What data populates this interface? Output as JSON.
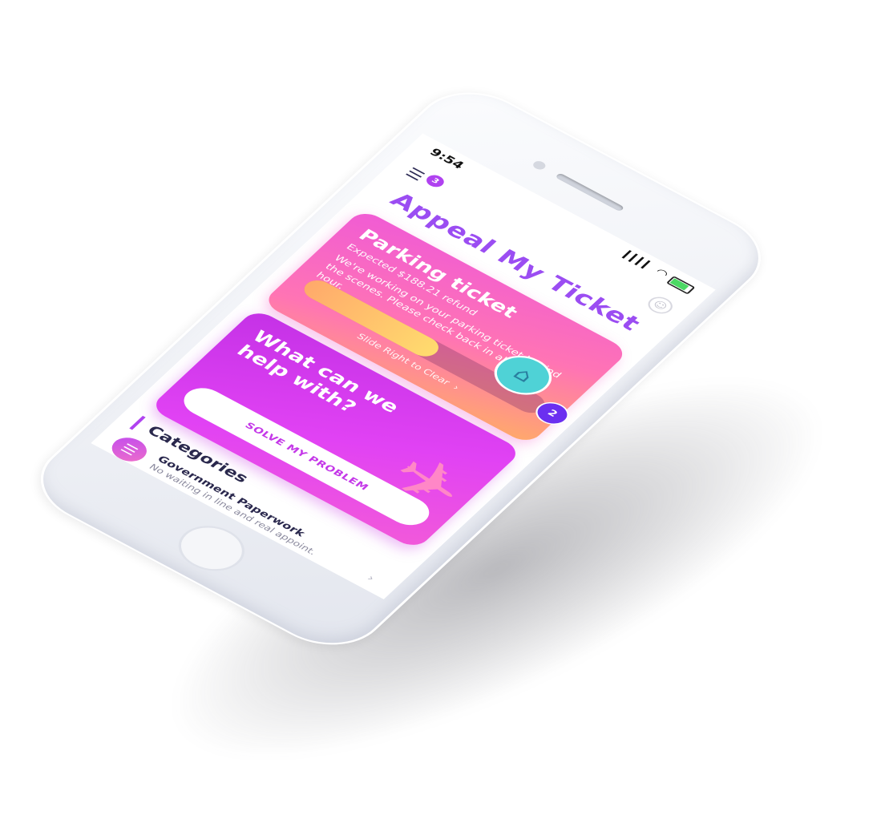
{
  "status_bar": {
    "time": "9:54",
    "location_glyph": "➤",
    "signal_glyph": "▎▎▎▎",
    "wifi_glyph": "◠"
  },
  "header": {
    "menu_glyph": "☰",
    "menu_badge": "3",
    "profile_glyph": "☺"
  },
  "app_title": "Appeal My Ticket",
  "ticket_card": {
    "title": "Parking ticket",
    "refund": "Expected $188.21 refund",
    "message": "We're working on your parking ticket behind the scenes. Please check back in about 1 hour.",
    "slider_hint": "Slide Right to Clear",
    "slider_chevron": "›",
    "progress": 0.55,
    "court_glyph": "⌂",
    "notification_count": "2"
  },
  "help_card": {
    "title": "What can we help with?",
    "button_label": "SOLVE MY PROBLEM",
    "plane_glyph": "✈"
  },
  "categories": {
    "heading": "Categories",
    "items": [
      {
        "name": "Government Paperwork",
        "description": "No waiting in line and real appoint.",
        "icon_glyph": "☰",
        "chevron": "›"
      }
    ]
  },
  "colors": {
    "accent": "#9b4df2",
    "badge": "#b042f0",
    "notification": "#6b2ff0",
    "ticket_gradient_start": "#f05bd5",
    "ticket_gradient_end": "#ffaa6a",
    "help_gradient_start": "#c431e6"
  }
}
